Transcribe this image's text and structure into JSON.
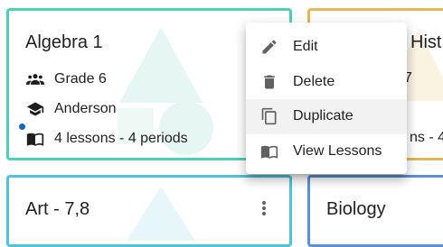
{
  "colors": {
    "teal_border": "#4dd0b8",
    "amber_border": "#e0b85a",
    "cyan_border": "#4fc3d9",
    "blue_border": "#5b8fd6"
  },
  "cards": [
    {
      "title": "Algebra 1",
      "grade": "Grade 6",
      "teacher": "Anderson",
      "lessons": "4 lessons - 4 periods"
    },
    {
      "title_partial": "Hist",
      "grade_partial": "7",
      "lessons_partial": "ns - 4"
    },
    {
      "title": "Art - 7,8"
    },
    {
      "title": "Biology"
    }
  ],
  "context_menu": {
    "items": [
      {
        "label": "Edit",
        "icon": "pencil-icon"
      },
      {
        "label": "Delete",
        "icon": "trash-icon"
      },
      {
        "label": "Duplicate",
        "icon": "copy-icon"
      },
      {
        "label": "View Lessons",
        "icon": "book-open-icon"
      }
    ]
  }
}
